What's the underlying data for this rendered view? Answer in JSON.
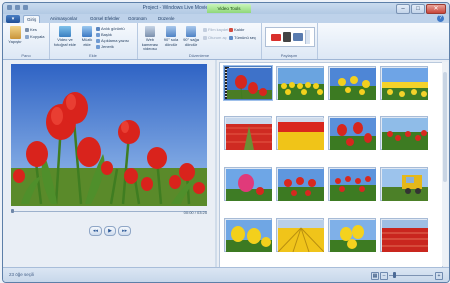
{
  "window": {
    "title": "Project - Windows Live Movie Maker",
    "contextual_tab": "Video Tools"
  },
  "ribbon_tabs": [
    "Giriş",
    "Animasyonlar",
    "Görsel Efektler",
    "Görünüm",
    "Düzenle"
  ],
  "ribbon": {
    "paste": "Yapıştır",
    "cut": "Kes",
    "copy": "Kopyala",
    "add_videos": "Video ve fotoğraf ekle",
    "add_music": "Müzik ekle",
    "snapshot": "Anlık görüntü",
    "title": "Başlık",
    "caption": "Açıklama yazısı",
    "credits": "Jenerik",
    "webcam": "Web kamerası videosu",
    "rotate_left": "90° sola döndür",
    "rotate_right": "90° sağa döndür",
    "remove": "Kaldır",
    "select_all": "Tümünü seç",
    "save_movie_disabled": "Film kaydet",
    "sign_in": "Oturum aç",
    "group_clipboard": "Pano",
    "group_add": "Ekle",
    "group_editing": "Düzenleme",
    "group_share": "Paylaşım"
  },
  "player": {
    "timecode": "00:00 / 03:25"
  },
  "status": {
    "text": "23 öğe seçili"
  },
  "colors": {
    "accent": "#3b73bf"
  }
}
